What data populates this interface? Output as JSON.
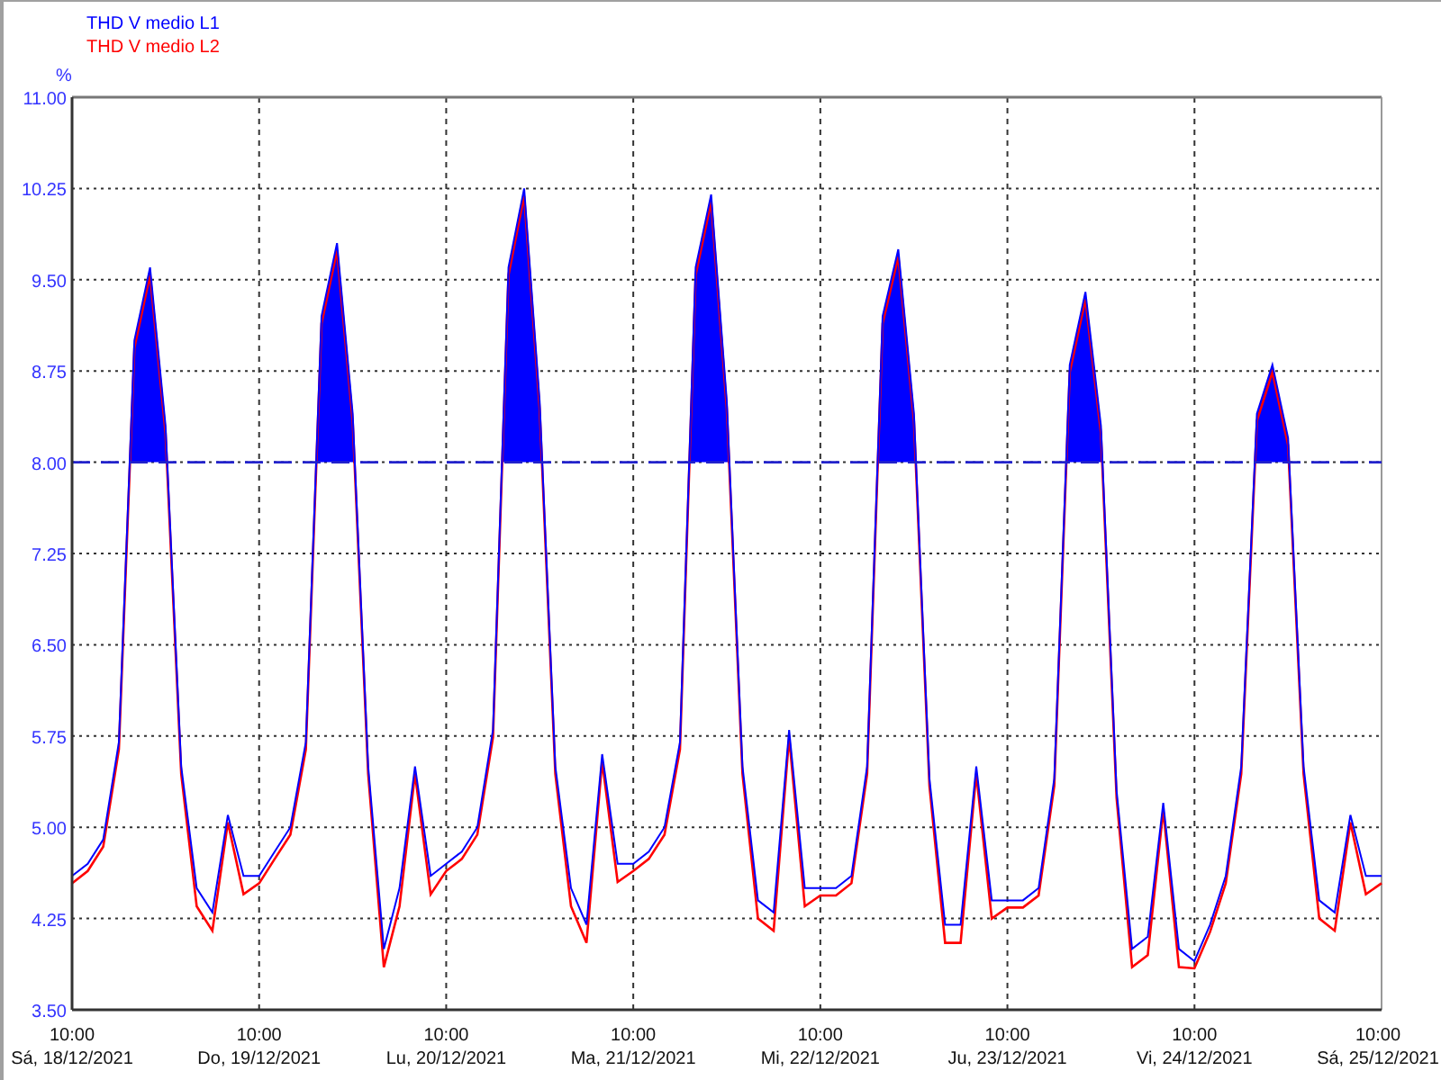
{
  "chart": {
    "chart_data": {
      "type": "line",
      "ylabel": "%",
      "categories": [
        "10:00\nSá, 18/12/2021",
        null,
        null,
        null,
        null,
        null,
        null,
        null,
        null,
        null,
        null,
        null,
        "10:00\nDo, 19/12/2021",
        null,
        null,
        null,
        null,
        null,
        null,
        null,
        null,
        null,
        null,
        null,
        "10:00\nLu, 20/12/2021",
        null,
        null,
        null,
        null,
        null,
        null,
        null,
        null,
        null,
        null,
        null,
        "10:00\nMa, 21/12/2021",
        null,
        null,
        null,
        null,
        null,
        null,
        null,
        null,
        null,
        null,
        null,
        "10:00\nMi, 22/12/2021",
        null,
        null,
        null,
        null,
        null,
        null,
        null,
        null,
        null,
        null,
        null,
        "10:00\nJu, 23/12/2021",
        null,
        null,
        null,
        null,
        null,
        null,
        null,
        null,
        null,
        null,
        null,
        "10:00\nVi, 24/12/2021",
        null,
        null,
        null,
        null,
        null,
        null,
        null,
        null,
        null,
        null,
        null,
        "10:00\nSá, 25/12/2021"
      ],
      "series": [
        {
          "name": "THD V medio L1",
          "color": "#0000ff",
          "values": [
            4.6,
            4.7,
            4.9,
            5.7,
            9.0,
            9.6,
            8.3,
            5.5,
            4.5,
            4.3,
            5.1,
            4.6,
            4.6,
            4.8,
            5.0,
            5.7,
            9.2,
            9.8,
            8.4,
            5.5,
            4.0,
            4.5,
            5.5,
            4.6,
            4.7,
            4.8,
            5.0,
            5.8,
            9.6,
            10.25,
            8.5,
            5.5,
            4.5,
            4.2,
            5.6,
            4.7,
            4.7,
            4.8,
            5.0,
            5.7,
            9.6,
            10.2,
            8.5,
            5.5,
            4.4,
            4.3,
            5.8,
            4.5,
            4.5,
            4.5,
            4.6,
            5.5,
            9.2,
            9.75,
            8.4,
            5.4,
            4.2,
            4.2,
            5.5,
            4.4,
            4.4,
            4.4,
            4.5,
            5.4,
            8.8,
            9.4,
            8.3,
            5.3,
            4.0,
            4.1,
            5.2,
            4.0,
            3.9,
            4.2,
            4.6,
            5.5,
            8.4,
            8.8,
            8.2,
            5.5,
            4.4,
            4.3,
            5.1,
            4.6,
            4.6
          ]
        },
        {
          "name": "THD V medio L2",
          "color": "#ff0000",
          "values": [
            4.54,
            4.64,
            4.84,
            5.64,
            8.94,
            9.54,
            8.24,
            5.44,
            4.35,
            4.15,
            5.04,
            4.45,
            4.54,
            4.74,
            4.94,
            5.64,
            9.14,
            9.74,
            8.34,
            5.44,
            3.85,
            4.35,
            5.44,
            4.45,
            4.64,
            4.74,
            4.94,
            5.74,
            9.54,
            10.19,
            8.44,
            5.44,
            4.35,
            4.05,
            5.54,
            4.55,
            4.64,
            4.74,
            4.94,
            5.64,
            9.54,
            10.14,
            8.44,
            5.44,
            4.25,
            4.15,
            5.74,
            4.35,
            4.44,
            4.44,
            4.54,
            5.44,
            9.14,
            9.69,
            8.34,
            5.34,
            4.05,
            4.05,
            5.44,
            4.25,
            4.34,
            4.34,
            4.44,
            5.34,
            8.74,
            9.34,
            8.24,
            5.24,
            3.85,
            3.95,
            5.14,
            3.85,
            3.84,
            4.14,
            4.54,
            5.44,
            8.34,
            8.74,
            8.14,
            5.44,
            4.25,
            4.15,
            5.04,
            4.45,
            4.54
          ]
        }
      ],
      "grid": true,
      "ylim": [
        3.5,
        11
      ],
      "yticks": [
        {
          "value": 3.5,
          "label": "3.50"
        },
        {
          "value": 4.25,
          "label": "4.25"
        },
        {
          "value": 5,
          "label": "5.00"
        },
        {
          "value": 5.75,
          "label": "5.75"
        },
        {
          "value": 6.5,
          "label": "6.50"
        },
        {
          "value": 7.25,
          "label": "7.25"
        },
        {
          "value": 8,
          "label": "8.00"
        },
        {
          "value": 8.75,
          "label": "8.75"
        },
        {
          "value": 9.5,
          "label": "9.50"
        },
        {
          "value": 10.25,
          "label": "10.25"
        },
        {
          "value": 11,
          "label": "11.00"
        }
      ],
      "ref_lines": [
        {
          "axis": "y",
          "value": 8
        }
      ]
    }
  }
}
